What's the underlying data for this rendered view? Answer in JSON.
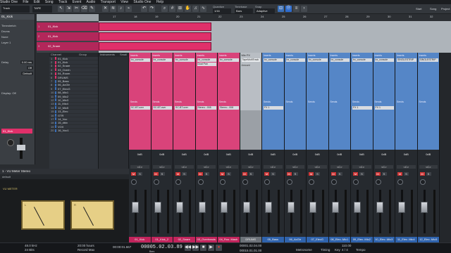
{
  "menubar": {
    "items": [
      "Studio One",
      "File",
      "Edit",
      "Song",
      "Track",
      "Event",
      "Audio",
      "Transport",
      "View",
      "Studio One",
      "Help"
    ]
  },
  "toolbar": {
    "song_name": "Track",
    "tape": "TAPE",
    "quantize_label": "Quantize",
    "quantize_value": "1/16",
    "timebase_label": "Timebase",
    "timebase_value": "Bars",
    "snap_label": "Snap",
    "snap_value": "Adaptive",
    "start_label": "Start",
    "song_label": "Song",
    "project_label": "Project"
  },
  "inspector": {
    "track_name": "01_Kick",
    "rows": [
      {
        "label": "Timestretch",
        "value": ""
      },
      {
        "label": "Drums",
        "value": ""
      },
      {
        "label": "None",
        "value": ""
      },
      {
        "label": "Layer 1",
        "value": ""
      },
      {
        "label": "Delay",
        "value": "0.00 ms"
      },
      {
        "label": "",
        "value": "Off"
      },
      {
        "label": "",
        "value": "Default"
      },
      {
        "label": "Display: Off",
        "value": ""
      }
    ],
    "selected_label": "01_Kick"
  },
  "ruler": {
    "marks": [
      "17",
      "18",
      "19",
      "20",
      "21",
      "22",
      "23",
      "24",
      "25",
      "26",
      "27",
      "28",
      "29",
      "30",
      "31",
      "32"
    ]
  },
  "arrange_tracks": [
    {
      "num": "1",
      "name": "01_Kick"
    },
    {
      "num": "2",
      "name": "01_Kick"
    },
    {
      "num": "3",
      "name": "02_Snare"
    }
  ],
  "browser": {
    "header_channel": "Channel",
    "header_group": "Group",
    "header_instruments": "Instruments",
    "header_small": "Small",
    "channels": [
      {
        "num": "1",
        "name": "01_Kick",
        "color": "#e0306a"
      },
      {
        "num": "2",
        "name": "01_Kick",
        "color": "#e0306a"
      },
      {
        "num": "3",
        "name": "02_Snare",
        "color": "#e0306a"
      },
      {
        "num": "4",
        "name": "03_Overh",
        "color": "#e0306a"
      },
      {
        "num": "5",
        "name": "04_Room",
        "color": "#e0306a"
      },
      {
        "num": "6",
        "name": "DRUMS",
        "color": "#e0306a"
      },
      {
        "num": "7",
        "name": "05_Bass",
        "color": "#3a6fb8"
      },
      {
        "num": "8",
        "name": "06_AcGtr",
        "color": "#3a6fb8"
      },
      {
        "num": "9",
        "name": "07_ElecG",
        "color": "#3a6fb8"
      },
      {
        "num": "10",
        "name": "08_Mic1",
        "color": "#3a6fb8"
      },
      {
        "num": "11",
        "name": "09_Mic2",
        "color": "#3a6fb8"
      },
      {
        "num": "12",
        "name": "10_Mic3",
        "color": "#3a6fb8"
      },
      {
        "num": "13",
        "name": "11_Mic4",
        "color": "#3a6fb8"
      },
      {
        "num": "14",
        "name": "12_Mic5",
        "color": "#3a6fb8"
      },
      {
        "num": "15",
        "name": "13_Elec",
        "color": "#3a6fb8"
      },
      {
        "num": "16",
        "name": "GTR",
        "color": "#3a6fb8"
      },
      {
        "num": "17",
        "name": "14_Voc",
        "color": "#3a6fb8"
      },
      {
        "num": "18",
        "name": "15_dblv",
        "color": "#3a6fb8"
      },
      {
        "num": "19",
        "name": "VOX",
        "color": "#3a6fb8"
      },
      {
        "num": "20",
        "name": "16_Voc1",
        "color": "#3a6fb8"
      }
    ]
  },
  "mixer": {
    "fx_header": "Mix FX",
    "fx_slot": "TapeMultiTrack",
    "fx_sub": "Amount",
    "strips": [
      {
        "insert": "Inserts",
        "slots": [
          "bx_console",
          ""
        ],
        "sends": "Sends",
        "send_slot": "SC-BT.over",
        "name": "01_Kick",
        "color": "#e0306a",
        "pan": "<C>",
        "vol": "0dB"
      },
      {
        "insert": "Inserts",
        "slots": [
          "bx_console",
          ""
        ],
        "sends": "Sends",
        "send_slot": "SC-BT.over",
        "name": "01_Kick_2",
        "color": "#e0306a",
        "pan": "<C>",
        "vol": "0dB"
      },
      {
        "insert": "Inserts",
        "slots": [
          "bx_console",
          ""
        ],
        "sends": "Sends",
        "send_slot": "SC-BT.over",
        "name": "02_Snare",
        "color": "#e0306a",
        "pan": "<C>",
        "vol": "0dB"
      },
      {
        "insert": "Inserts",
        "slots": [
          "bx_console",
          "Dual Pan"
        ],
        "sends": "Sends",
        "send_slot": "Stereo...008",
        "name": "03_Overheads",
        "color": "#e0306a",
        "pan": "<C>",
        "vol": "0dB"
      },
      {
        "insert": "Inserts",
        "slots": [
          "bx_console",
          ""
        ],
        "sends": "Sends",
        "send_slot": "Stereo...008",
        "name": "04_Roo..Mash",
        "color": "#e0306a",
        "pan": "<C>",
        "vol": "0dB"
      },
      {
        "insert": "Inserts",
        "slots": [
          "bx_console",
          ""
        ],
        "sends": "Sends",
        "send_slot": "FX 1",
        "name": "DRUMS",
        "color": "#8a8f96",
        "pan": "<C>",
        "vol": "0dB"
      },
      {
        "insert": "Inserts",
        "slots": [
          "bx_console",
          ""
        ],
        "sends": "Sends",
        "send_slot": "FX 1",
        "name": "05_Bass",
        "color": "#3a6fb8",
        "pan": "<C>",
        "vol": "0dB"
      },
      {
        "insert": "Inserts",
        "slots": [
          "bx_console",
          ""
        ],
        "sends": "Sends",
        "send_slot": "",
        "name": "06_AcGtr",
        "color": "#3a6fb8",
        "pan": "<C>",
        "vol": "0dB"
      },
      {
        "insert": "Inserts",
        "slots": [
          "bx_console",
          ""
        ],
        "sends": "Sends",
        "send_slot": "",
        "name": "07_ElecG",
        "color": "#3a6fb8",
        "pan": "<C>",
        "vol": "0dB"
      },
      {
        "insert": "Inserts",
        "slots": [
          "bx_console",
          ""
        ],
        "sends": "Sends",
        "send_slot": "",
        "name": "08_Elec..Mic1",
        "color": "#3a6fb8",
        "pan": "<C>",
        "vol": "0dB"
      },
      {
        "insert": "Inserts",
        "slots": [
          "bx_console",
          ""
        ],
        "sends": "Sends",
        "send_slot": "FX 1",
        "name": "09_Elec..Mic2",
        "color": "#3a6fb8",
        "pan": "<C>",
        "vol": "0dB"
      },
      {
        "insert": "Inserts",
        "slots": [
          "bx_console",
          ""
        ],
        "sends": "Sends",
        "send_slot": "FX 1",
        "name": "10_Elec..Mic3",
        "color": "#3a6fb8",
        "pan": "<C>",
        "vol": "0dB"
      },
      {
        "insert": "Inserts",
        "slots": [
          "SINGLESTRIP",
          ""
        ],
        "sends": "Sends",
        "send_slot": "",
        "name": "11_Elec..Mic4",
        "color": "#3a6fb8",
        "pan": "<C>",
        "vol": "0dB"
      },
      {
        "insert": "Inserts",
        "slots": [
          "SINGLESTRIP",
          ""
        ],
        "sends": "Sends",
        "send_slot": "",
        "name": "12_Elec..Mic5",
        "color": "#3a6fb8",
        "pan": "<C>",
        "vol": "0dB"
      }
    ]
  },
  "plugin": {
    "title": "1 - VU Meter Stereo",
    "preset": "default",
    "brand": "VU METER",
    "left_label": "L",
    "right_label": "R"
  },
  "status": {
    "sample_rate": "48.0 kHz",
    "bit_depth": "24 Bits",
    "record_max": "20:00 hours",
    "record_label": "Record Max",
    "time": "00:00:01.667",
    "position": "00005.02.03.89",
    "position_label": "Bars",
    "loop_start": "00001.02.04.00",
    "loop_end": "00015.01.01.00",
    "tempo": "110.00",
    "time_sig": "4 / 4",
    "metronome_label": "Metronome",
    "timing_label": "Timing",
    "key_label": "Key",
    "tempo_label": "Tempo"
  }
}
